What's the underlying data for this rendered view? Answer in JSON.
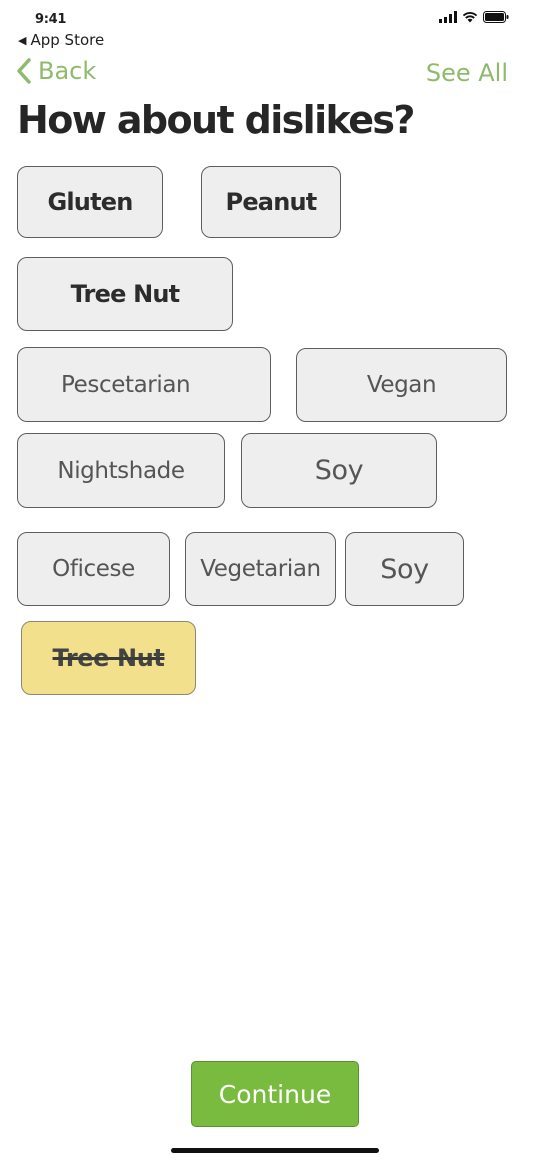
{
  "status_bar": {
    "time": "9:41",
    "back_app": "App Store"
  },
  "nav": {
    "back_label": "Back",
    "see_all_label": "See All",
    "accent_color": "#8dbb6b"
  },
  "title": "How about dislikes?",
  "chips": [
    {
      "label": "Gluten"
    },
    {
      "label": "Peanut"
    },
    {
      "label": "Tree Nut"
    },
    {
      "label": "Pescetarian"
    },
    {
      "label": "Vegan"
    },
    {
      "label": "Nightshade"
    },
    {
      "label": "Soy"
    },
    {
      "label": "Oficese"
    },
    {
      "label": "Vegetarian"
    },
    {
      "label": "Soy"
    },
    {
      "label": "Tree Nut",
      "selected": true
    }
  ],
  "continue_label": "Continue",
  "colors": {
    "chip_bg": "#eeeeee",
    "chip_selected_bg": "#f2e08c",
    "continue_bg": "#78bb3f"
  }
}
